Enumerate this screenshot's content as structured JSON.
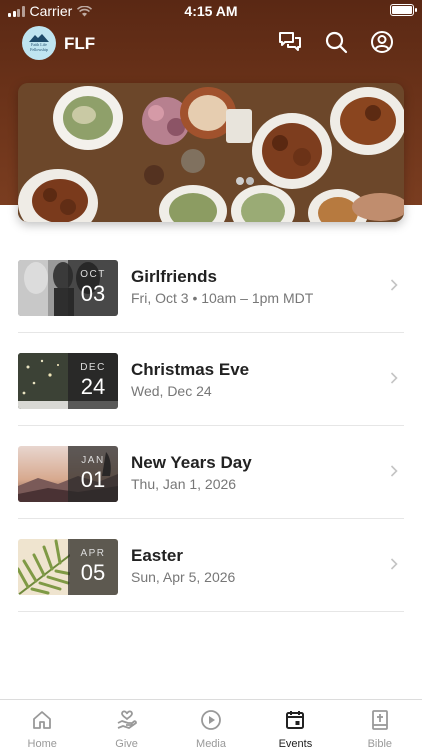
{
  "status": {
    "carrier": "Carrier",
    "time": "4:15 AM"
  },
  "header": {
    "brand": "FLF",
    "logo_lines": [
      "Faith Life",
      "Fellowship"
    ]
  },
  "icons": {
    "chat": "chat-bubbles-icon",
    "search": "search-icon",
    "profile": "profile-icon"
  },
  "events": [
    {
      "month": "OCT",
      "day": "03",
      "title": "Girlfriends",
      "subtitle": "Fri, Oct 3 • 10am – 1pm MDT"
    },
    {
      "month": "DEC",
      "day": "24",
      "title": "Christmas Eve",
      "subtitle": "Wed, Dec 24"
    },
    {
      "month": "JAN",
      "day": "01",
      "title": "New Years Day",
      "subtitle": "Thu, Jan 1, 2026"
    },
    {
      "month": "APR",
      "day": "05",
      "title": "Easter",
      "subtitle": "Sun, Apr 5, 2026"
    }
  ],
  "tabs": [
    {
      "label": "Home",
      "icon": "home-icon"
    },
    {
      "label": "Give",
      "icon": "give-icon"
    },
    {
      "label": "Media",
      "icon": "media-play-icon"
    },
    {
      "label": "Events",
      "icon": "calendar-icon",
      "active": true
    },
    {
      "label": "Bible",
      "icon": "bible-icon"
    }
  ],
  "colors": {
    "header": "#6a3219",
    "accent_text": "#222222",
    "muted": "#777777"
  }
}
